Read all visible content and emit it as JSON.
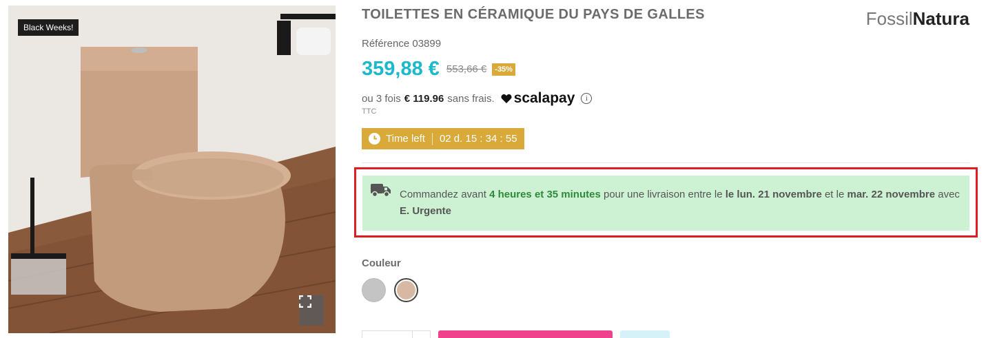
{
  "gallery": {
    "badge": "Black Weeks!",
    "image_alt": "toilet-product-image"
  },
  "product": {
    "title": "TOILETTES EN CÉRAMIQUE DU PAYS DE GALLES",
    "brand_part1": "Fossil",
    "brand_part2": "Natura",
    "reference": "Référence 03899",
    "price": "359,88 €",
    "old_price": "553,66 €",
    "discount": "-35%",
    "installment_prefix": "ou 3 fois",
    "installment_amount": "€ 119.96",
    "installment_suffix": "sans frais.",
    "scalapay": "scalapay",
    "tax_note": "TTC"
  },
  "countdown": {
    "label": "Time left",
    "value": "02 d. 15 : 34 : 55"
  },
  "delivery": {
    "text1": "Commandez avant ",
    "highlight": "4 heures et 35 minutes",
    "text2": " pour une livraison entre le ",
    "date1": "le lun. 21 novembre",
    "text3": " et le ",
    "date2": "mar. 22 novembre",
    "text4": " avec ",
    "carrier": "E. Urgente"
  },
  "options": {
    "color_label": "Couleur",
    "colors": [
      {
        "name": "grey",
        "hex": "#c4c4c4"
      },
      {
        "name": "beige",
        "hex": "#d7b9a3"
      }
    ]
  },
  "theme": {
    "accent_price": "#1cb9cc",
    "gold": "#d9a93a",
    "delivery_bg": "#cdf2d3",
    "highlight_frame": "#e01b24",
    "cart_button": "#f0418d"
  }
}
